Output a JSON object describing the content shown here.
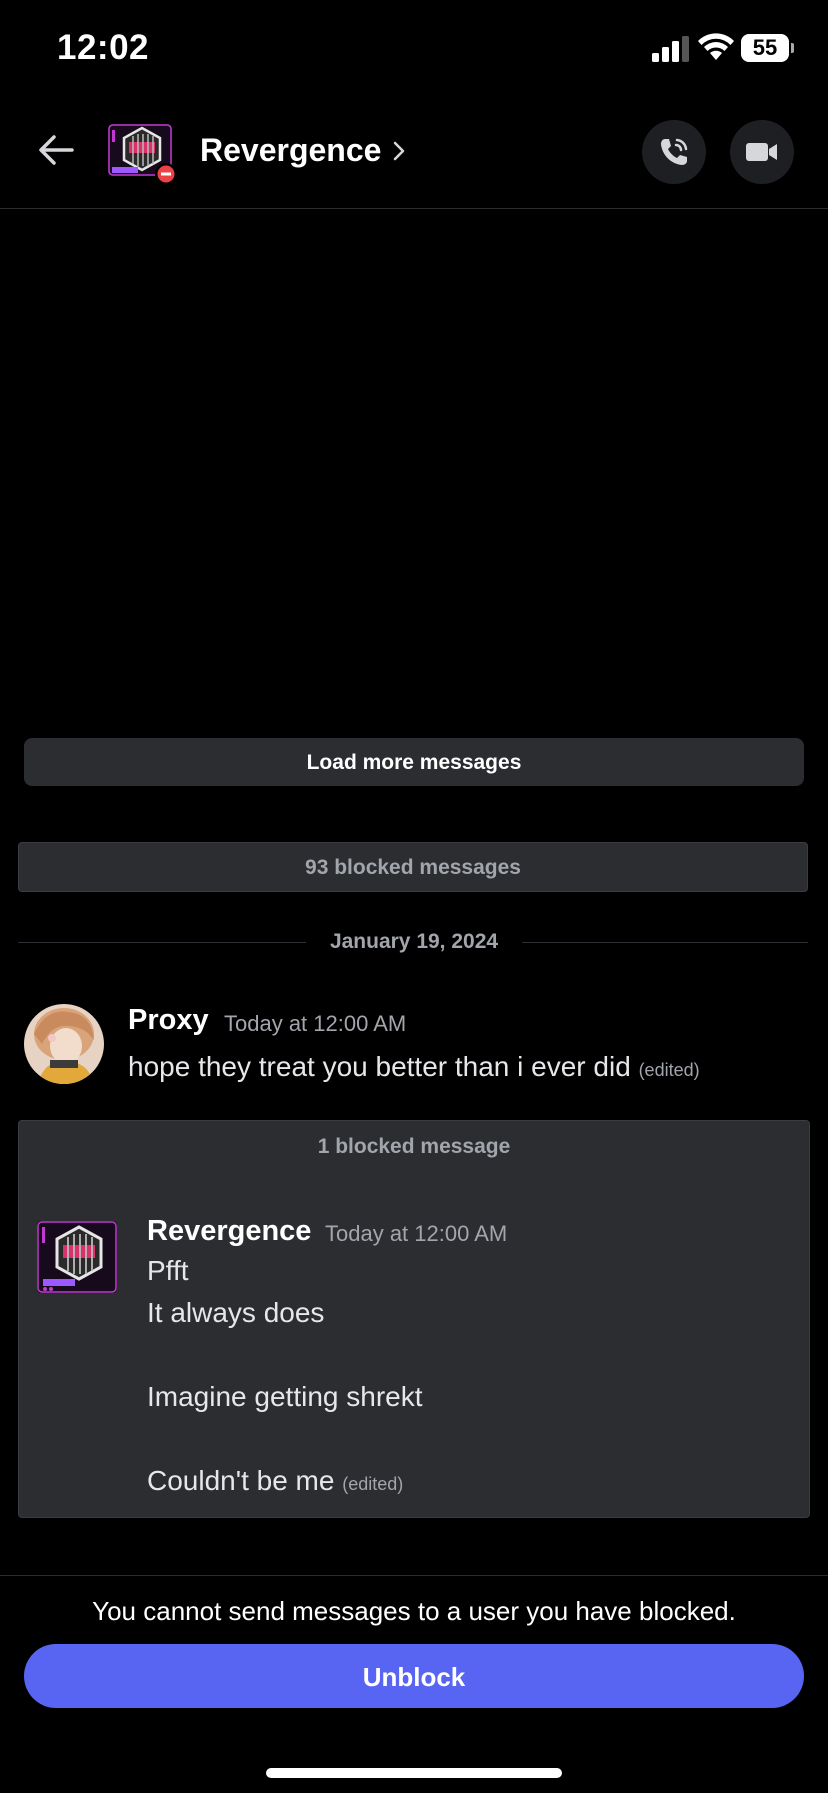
{
  "status_bar": {
    "time": "12:02",
    "battery": "55"
  },
  "header": {
    "title": "Revergence",
    "icons": [
      "back-arrow-icon",
      "chevron-right-icon",
      "phone-icon",
      "video-camera-icon",
      "blocked-badge-icon"
    ]
  },
  "chat": {
    "load_more_label": "Load more messages",
    "blocked_summary": "93 blocked messages",
    "date_divider": "January 19, 2024",
    "messages": [
      {
        "author": "Proxy",
        "timestamp": "Today at 12:00 AM",
        "lines": [
          "hope they treat you better than i ever did"
        ],
        "edited": "(edited)"
      }
    ],
    "blocked_group": {
      "label": "1 blocked message",
      "author": "Revergence",
      "timestamp": "Today at 12:00 AM",
      "lines": [
        "Pfft",
        "It always does",
        "Imagine getting shrekt",
        "Couldn't be me"
      ],
      "edited": "(edited)"
    }
  },
  "footer": {
    "notice": "You cannot send messages to a user you have blocked.",
    "unblock_label": "Unblock"
  },
  "colors": {
    "background": "#000000",
    "surface": "#2b2d31",
    "accent": "#5865f2",
    "muted_text": "#a2a5ab",
    "blocked_badge": "#ed4245"
  }
}
